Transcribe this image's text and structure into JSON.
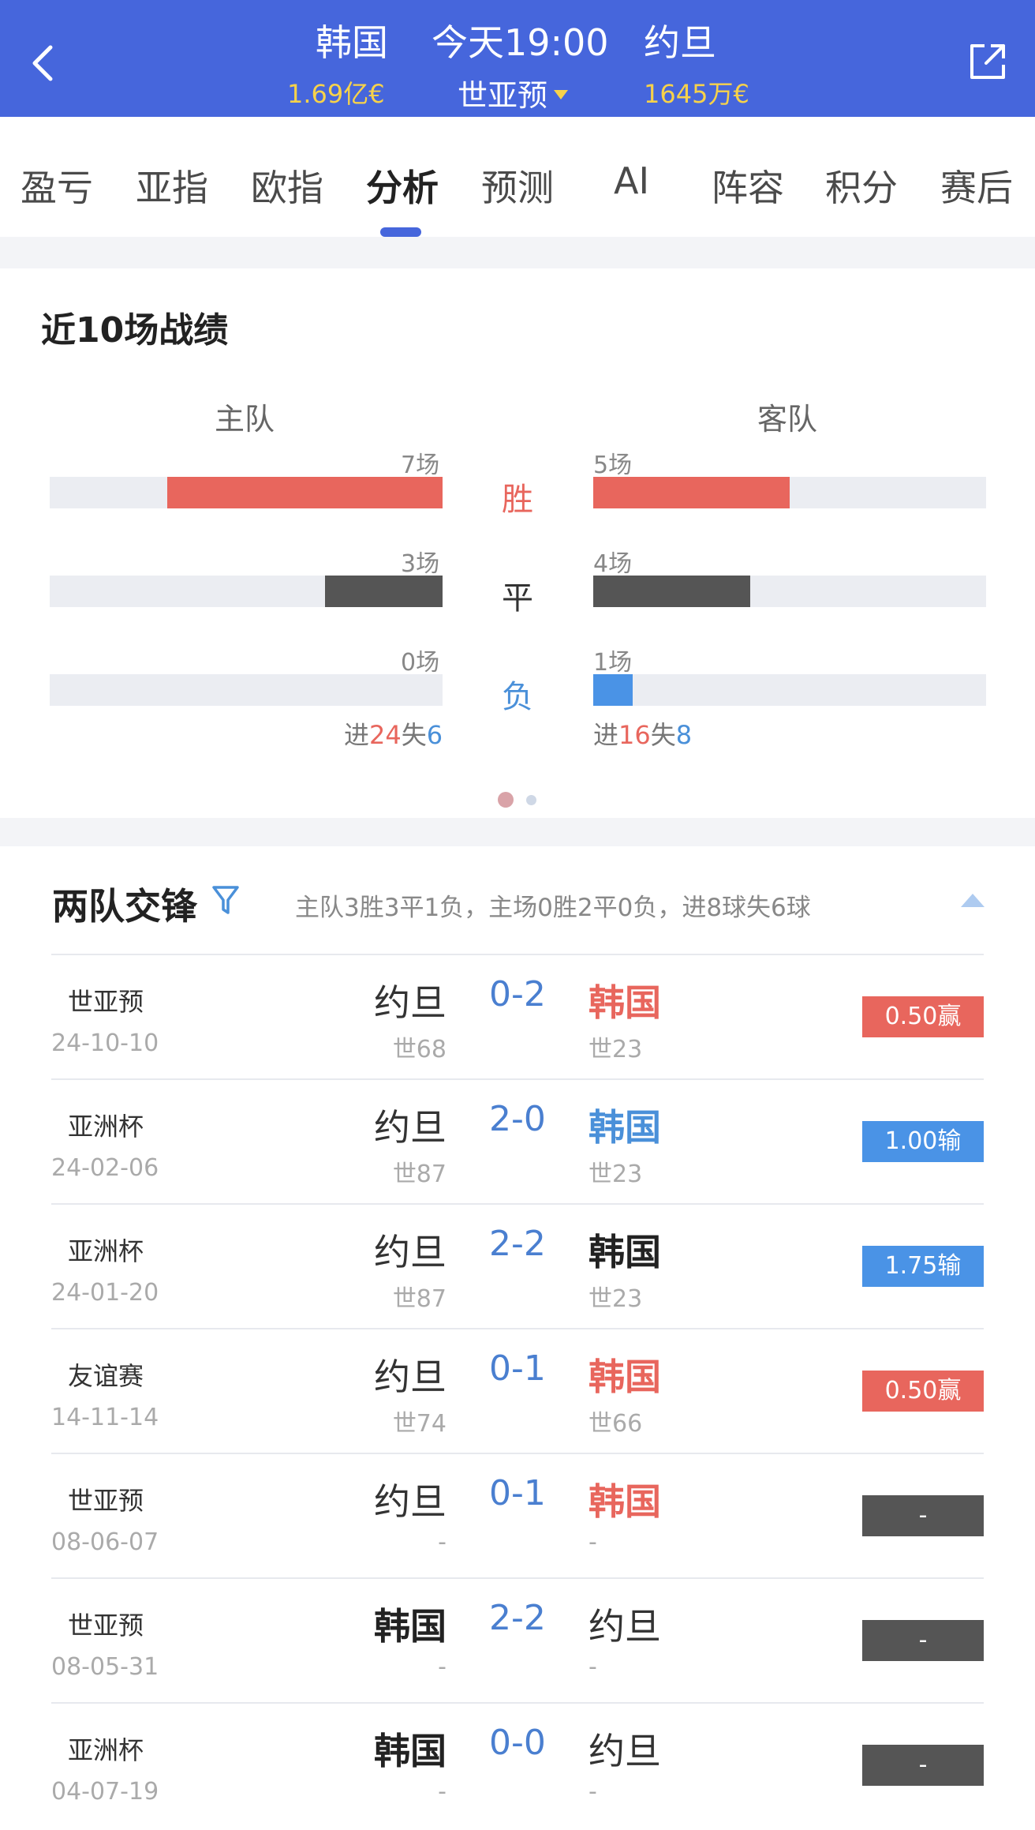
{
  "header": {
    "home_team": "韩国",
    "match_time": "今天19:00",
    "away_team": "约旦",
    "home_value": "1.69亿€",
    "league": "世亚预",
    "away_value": "1645万€"
  },
  "tabs": [
    {
      "label": "盈亏"
    },
    {
      "label": "亚指"
    },
    {
      "label": "欧指"
    },
    {
      "label": "分析",
      "active": true
    },
    {
      "label": "预测"
    },
    {
      "label": "AI"
    },
    {
      "label": "阵容"
    },
    {
      "label": "积分"
    },
    {
      "label": "赛后"
    }
  ],
  "recent": {
    "title": "近10场战绩",
    "home_label": "主队",
    "away_label": "客队",
    "stats": [
      {
        "label": "胜",
        "home_count": "7场",
        "home_value": 7,
        "away_count": "5场",
        "away_value": 5,
        "color": "#e8665d"
      },
      {
        "label": "平",
        "home_count": "3场",
        "home_value": 3,
        "away_count": "4场",
        "away_value": 4,
        "color": "#555555"
      },
      {
        "label": "负",
        "home_count": "0场",
        "home_value": 0,
        "away_count": "1场",
        "away_value": 1,
        "color": "#4a93e6"
      }
    ],
    "home_goals": {
      "gf_label": "进",
      "gf": "24",
      "ga_label": "失",
      "ga": "6"
    },
    "away_goals": {
      "gf_label": "进",
      "gf": "16",
      "ga_label": "失",
      "ga": "8"
    }
  },
  "h2h": {
    "title": "两队交锋",
    "summary": "主队3胜3平1负，主场0胜2平0负，进8球失6球",
    "matches": [
      {
        "league": "世亚预",
        "date": "24-10-10",
        "home": "约旦",
        "home_rank": "世68",
        "score": "0-2",
        "away": "韩国",
        "away_rank": "世23",
        "away_style": "red",
        "result": "0.50赢",
        "result_type": "win"
      },
      {
        "league": "亚洲杯",
        "date": "24-02-06",
        "home": "约旦",
        "home_rank": "世87",
        "score": "2-0",
        "away": "韩国",
        "away_rank": "世23",
        "away_style": "blue",
        "result": "1.00输",
        "result_type": "lose"
      },
      {
        "league": "亚洲杯",
        "date": "24-01-20",
        "home": "约旦",
        "home_rank": "世87",
        "score": "2-2",
        "away": "韩国",
        "away_rank": "世23",
        "away_style": "bold",
        "result": "1.75输",
        "result_type": "lose"
      },
      {
        "league": "友谊赛",
        "date": "14-11-14",
        "home": "约旦",
        "home_rank": "世74",
        "score": "0-1",
        "away": "韩国",
        "away_rank": "世66",
        "away_style": "red",
        "result": "0.50赢",
        "result_type": "win"
      },
      {
        "league": "世亚预",
        "date": "08-06-07",
        "home": "约旦",
        "home_rank": "-",
        "score": "0-1",
        "away": "韩国",
        "away_rank": "-",
        "away_style": "red",
        "result": "-",
        "result_type": "none"
      },
      {
        "league": "世亚预",
        "date": "08-05-31",
        "home": "韩国",
        "home_rank": "-",
        "score": "2-2",
        "away": "约旦",
        "away_rank": "-",
        "home_style": "bold",
        "result": "-",
        "result_type": "none"
      },
      {
        "league": "亚洲杯",
        "date": "04-07-19",
        "home": "韩国",
        "home_rank": "-",
        "score": "0-0",
        "away": "约旦",
        "away_rank": "-",
        "home_style": "bold",
        "result": "-",
        "result_type": "none"
      }
    ]
  },
  "colors": {
    "header_bg": "#4666dc",
    "win": "#e8665d",
    "lose": "#4a93e6",
    "draw": "#555555"
  }
}
